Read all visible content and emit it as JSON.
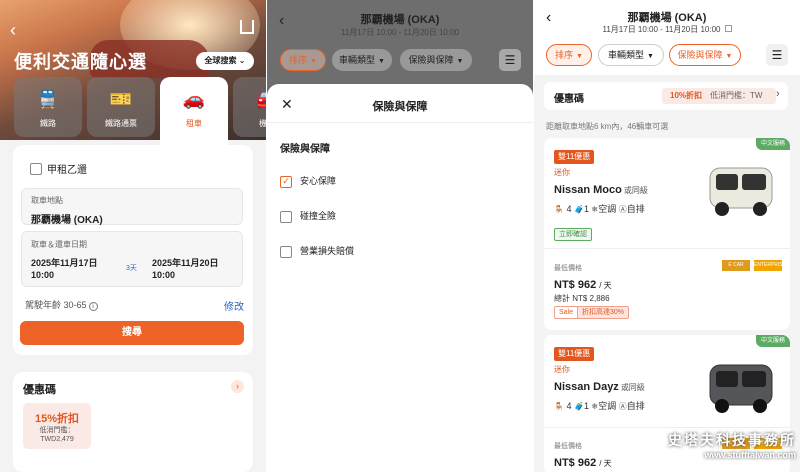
{
  "left": {
    "title": "便利交通隨心選",
    "global_search": "全球搜索",
    "modes": [
      {
        "icon": "train-icon",
        "label": "鐵路"
      },
      {
        "icon": "rail-pass-icon",
        "label": "鐵路通票"
      },
      {
        "icon": "car-icon",
        "label": "租車"
      },
      {
        "icon": "airport-icon",
        "label": "機場"
      }
    ],
    "one_way": "甲租乙還",
    "pickup_label": "取車地點",
    "pickup_value": "那覇機場 (OKA)",
    "date_label": "取車＆還車日期",
    "pickup_date": "2025年11月17日",
    "pickup_time": "10:00",
    "days": "3天",
    "return_date": "2025年11月20日",
    "return_time": "10:00",
    "age": "駕駛年齡 30-65",
    "edit": "修改",
    "search": "搜尋",
    "coupon_title": "優惠碼",
    "coupon_amount": "15%折扣",
    "coupon_min": "低消門檻：",
    "coupon_min_value": "TWD2,479"
  },
  "middle": {
    "title": "那覇機場 (OKA)",
    "dates": "11月17日 10:00 - 11月20日 10:00",
    "chips": [
      "排序",
      "車輛類型",
      "保險與保障"
    ],
    "sheet_title": "保險與保障",
    "section": "保險與保障",
    "options": [
      "安心保障",
      "碰撞全險",
      "營業損失賠償"
    ]
  },
  "right": {
    "title": "那覇機場 (OKA)",
    "dates": "11月17日 10:00 - 11月20日 10:00",
    "chips": [
      "排序",
      "車輛類型",
      "保險與保障"
    ],
    "coupon_title": "優惠碼",
    "coupon_tag": "10%折扣",
    "coupon_min": "低消門檻：TW",
    "distance": "距離取車地點6 km內，46輛車可選",
    "cars": [
      {
        "badge_zh": "中文服務",
        "sale": "雙11優惠",
        "cls": "迷你",
        "name": "Nissan Moco",
        "alt": "或同級",
        "seats": "4",
        "bags": "1",
        "ac": "空調",
        "trans": "自排",
        "instant": "立即確認",
        "lowest": "最低價格",
        "logo1": "E CAR RENTAL",
        "logo2": "ENTERPRISE",
        "price": "NT$ 962",
        "per": "/ 天",
        "total": "總計 NT$ 2,886",
        "pill_a": "Sale",
        "pill_b": "折扣高達30%",
        "color": "#f0efe8"
      },
      {
        "badge_zh": "中文服務",
        "sale": "雙11優惠",
        "cls": "迷你",
        "name": "Nissan Dayz",
        "alt": "或同級",
        "seats": "4",
        "bags": "1",
        "ac": "空調",
        "trans": "自排",
        "lowest": "最低價格",
        "logo1": "E CAR RENTAL",
        "logo2": "ENTERPRISE",
        "price": "NT$ 962",
        "per": "/ 天",
        "color": "#5b5c60"
      }
    ],
    "watermark_a": "史塔夫科技事務所",
    "watermark_b": "www.stufftaiwan.com"
  },
  "colors": {
    "accent": "#ec6227",
    "green": "#5bab62"
  }
}
